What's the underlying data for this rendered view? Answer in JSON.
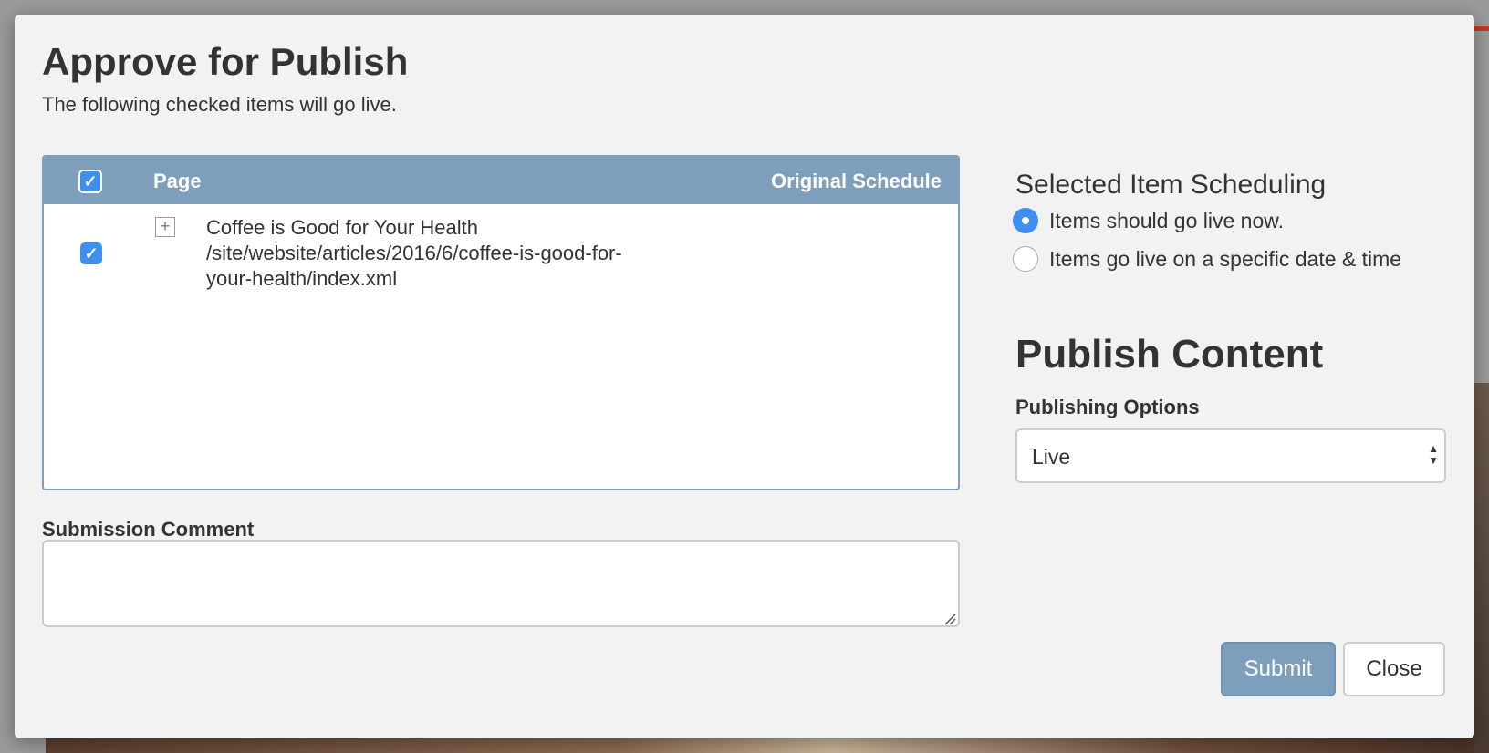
{
  "dialog": {
    "title": "Approve for Publish",
    "subtitle": "The following checked items will go live."
  },
  "items_table": {
    "columns": [
      "Page",
      "Original Schedule"
    ],
    "select_all_checked": true,
    "rows": [
      {
        "checked": true,
        "title": "Coffee is Good for Your Health",
        "path": "/site/website/articles/2016/6/coffee-is-good-for-your-health/index.xml",
        "schedule": ""
      }
    ]
  },
  "comment": {
    "label": "Submission Comment",
    "value": ""
  },
  "scheduling": {
    "heading": "Selected Item Scheduling",
    "options": [
      {
        "label": "Items should go live now.",
        "selected": true
      },
      {
        "label": "Items go live on a specific date & time",
        "selected": false
      }
    ]
  },
  "publish": {
    "heading": "Publish Content",
    "options_label": "Publishing Options",
    "selected_option": "Live"
  },
  "buttons": {
    "submit": "Submit",
    "close": "Close"
  },
  "colors": {
    "accent": "#7e9fbb",
    "checkbox": "#3d8ff0"
  }
}
